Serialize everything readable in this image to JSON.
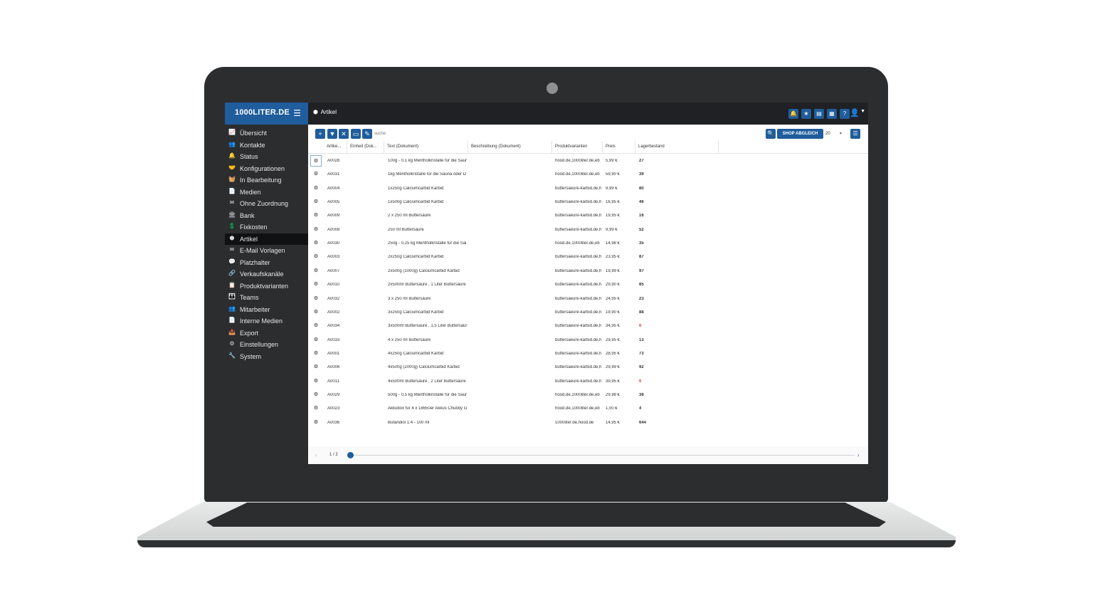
{
  "app": {
    "brand": "1000LITER.DE",
    "page_title": "Artikel"
  },
  "icons": {
    "menu": "hamburger-icon",
    "cube": "cube-icon",
    "bell": "bell-icon",
    "star": "star-icon",
    "book": "book-icon",
    "calendar": "calendar-icon",
    "help": "help-icon",
    "user": "user-icon",
    "gear": "gear-icon"
  },
  "colors": {
    "accent": "#1f5d9c",
    "sidebar": "#2b2d2f",
    "active": "#101113",
    "stock_zero": "#d9302c"
  },
  "sidebar": {
    "items": [
      {
        "label": "Übersicht",
        "icon": "chart-icon",
        "glyph": "📈"
      },
      {
        "label": "Kontakte",
        "icon": "users-icon",
        "glyph": "👥"
      },
      {
        "label": "Status",
        "icon": "bell-icon",
        "glyph": "🔔"
      },
      {
        "label": "Konfigurationen",
        "icon": "handshake-icon",
        "glyph": "🤝"
      },
      {
        "label": "In Bearbeitung",
        "icon": "basket-icon",
        "glyph": "🧺"
      },
      {
        "label": "Medien",
        "icon": "file-icon",
        "glyph": "📄"
      },
      {
        "label": "Ohne Zuordnung",
        "icon": "envelope-icon",
        "glyph": "✉"
      },
      {
        "label": "Bank",
        "icon": "bank-icon",
        "glyph": "🏛"
      },
      {
        "label": "Fixkosten",
        "icon": "coins-icon",
        "glyph": "💲"
      },
      {
        "label": "Artikel",
        "icon": "cube-icon",
        "glyph": "⬢"
      },
      {
        "label": "E-Mail Vorlagen",
        "icon": "envelope-icon",
        "glyph": "✉"
      },
      {
        "label": "Platzhalter",
        "icon": "comment-icon",
        "glyph": "💬"
      },
      {
        "label": "Verkaufskanäle",
        "icon": "link-icon",
        "glyph": "🔗"
      },
      {
        "label": "Produktvarianten",
        "icon": "clipboard-icon",
        "glyph": "📋"
      },
      {
        "label": "Teams",
        "icon": "team-icon",
        "glyph": "👪"
      },
      {
        "label": "Mitarbeiter",
        "icon": "users-icon",
        "glyph": "👥"
      },
      {
        "label": "Interne Medien",
        "icon": "file-icon",
        "glyph": "📄"
      },
      {
        "label": "Export",
        "icon": "export-icon",
        "glyph": "📤"
      },
      {
        "label": "Einstellungen",
        "icon": "gear-icon",
        "glyph": "⚙"
      },
      {
        "label": "System",
        "icon": "wrench-icon",
        "glyph": "🔧"
      }
    ],
    "active_index": 9
  },
  "toolbar": {
    "add": "+",
    "filter": "▼",
    "clear": "✕",
    "save": "▭",
    "edit": "✎",
    "search_placeholder": "suche",
    "search": "🔍",
    "shop_sync": "SHOP ABGLEICH",
    "page_size": "20",
    "page_size_caret": "▾",
    "list": "☰"
  },
  "table": {
    "columns": [
      "Artike...",
      "Einheit (Dok...",
      "Text (Dokument)",
      "Beschreibung (Dokument)",
      "Produktvarianten",
      "Preis",
      "Lagerbestand"
    ],
    "rows": [
      {
        "id": "A0028",
        "text": "100g - 0,1 kg Mentholkristalle für die Saur",
        "variants": "hood.de,1000liter.de,eb",
        "price": "5,99 €",
        "stock": "27"
      },
      {
        "id": "A0031",
        "text": "1kg Mentholkristalle für die Sauna oder D",
        "variants": "hood.de,1000liter.de,eb",
        "price": "59,90 €",
        "stock": "39"
      },
      {
        "id": "A0004",
        "text": "1x250g Calciumcarbid Karbid",
        "variants": "buttersaeure-karbid.de,h",
        "price": "9,99 €",
        "stock": "80"
      },
      {
        "id": "A0005",
        "text": "1x500g Calciumcarbid Karbid",
        "variants": "buttersaeure-karbid.de,h",
        "price": "16,95 €",
        "stock": "46"
      },
      {
        "id": "A0009",
        "text": "2 x 250 ml Buttersäure",
        "variants": "buttersaeure-karbid.de,h",
        "price": "19,95 €",
        "stock": "16"
      },
      {
        "id": "A0008",
        "text": "250 ml Buttersäure",
        "variants": "buttersaeure-karbid.de,h",
        "price": "9,99 €",
        "stock": "52"
      },
      {
        "id": "A0030",
        "text": "250g - 0,25 kg Mentholkristalle für die Sai",
        "variants": "hood.de,1000liter.de,eb",
        "price": "14,98 €",
        "stock": "35"
      },
      {
        "id": "A0003",
        "text": "2x250g Calciumcarbid Karbid",
        "variants": "buttersaeure-karbid.de,h",
        "price": "23,95 €",
        "stock": "87"
      },
      {
        "id": "A0007",
        "text": "2x500g (1000g) Calciumcarbid Karbid",
        "variants": "buttersaeure-karbid.de,h",
        "price": "19,99 €",
        "stock": "97"
      },
      {
        "id": "A0010",
        "text": "2x500ml Buttersäure , 1 Liter Buttersäure",
        "variants": "buttersaeure-karbid.de,h",
        "price": "29,90 €",
        "stock": "85"
      },
      {
        "id": "A0032",
        "text": "3 x 250 ml Buttersäure",
        "variants": "buttersaeure-karbid.de,h",
        "price": "24,95 €",
        "stock": "23"
      },
      {
        "id": "A0002",
        "text": "3x250g Calciumcarbid Karbid",
        "variants": "buttersaeure-karbid.de,h",
        "price": "19,90 €",
        "stock": "88"
      },
      {
        "id": "A0034",
        "text": "3x500ml Buttersäure , 1,5 Liter Buttersäur",
        "variants": "buttersaeure-karbid.de,h",
        "price": "34,95 €",
        "stock": "0"
      },
      {
        "id": "A0033",
        "text": "4 x 250 ml Buttersäure",
        "variants": "buttersaeure-karbid.de,h",
        "price": "29,95 €",
        "stock": "13"
      },
      {
        "id": "A0001",
        "text": "4x250g Calciumcarbid Karbid",
        "variants": "buttersaeure-karbid.de,h",
        "price": "28,95 €",
        "stock": "73"
      },
      {
        "id": "A0006",
        "text": "4x500g (2000g) Calciumcarbid Karbid",
        "variants": "buttersaeure-karbid.de,h",
        "price": "29,99 €",
        "stock": "92"
      },
      {
        "id": "A0011",
        "text": "4x500ml Buttersäure , 2 Liter Buttersäure",
        "variants": "buttersaeure-karbid.de,h",
        "price": "39,95 €",
        "stock": "0"
      },
      {
        "id": "A0029",
        "text": "500g - 0,5 kg Mentholkristalle für die Saur",
        "variants": "hood.de,1000liter.de,eb",
        "price": "29,98 €",
        "stock": "38"
      },
      {
        "id": "A0023",
        "text": "Akkubox für 4 x 18650er Akkus Chubby G",
        "variants": "hood.de,1000liter.de,eb",
        "price": "1,00 €",
        "stock": "4"
      },
      {
        "id": "A0036",
        "text": "Butandiol 1.4 - 100 ml",
        "variants": "1000liter.de,hood.de",
        "price": "14,95 €",
        "stock": "644"
      }
    ]
  },
  "pager": {
    "prev": "‹",
    "page": "1 / 2",
    "next": "›"
  }
}
